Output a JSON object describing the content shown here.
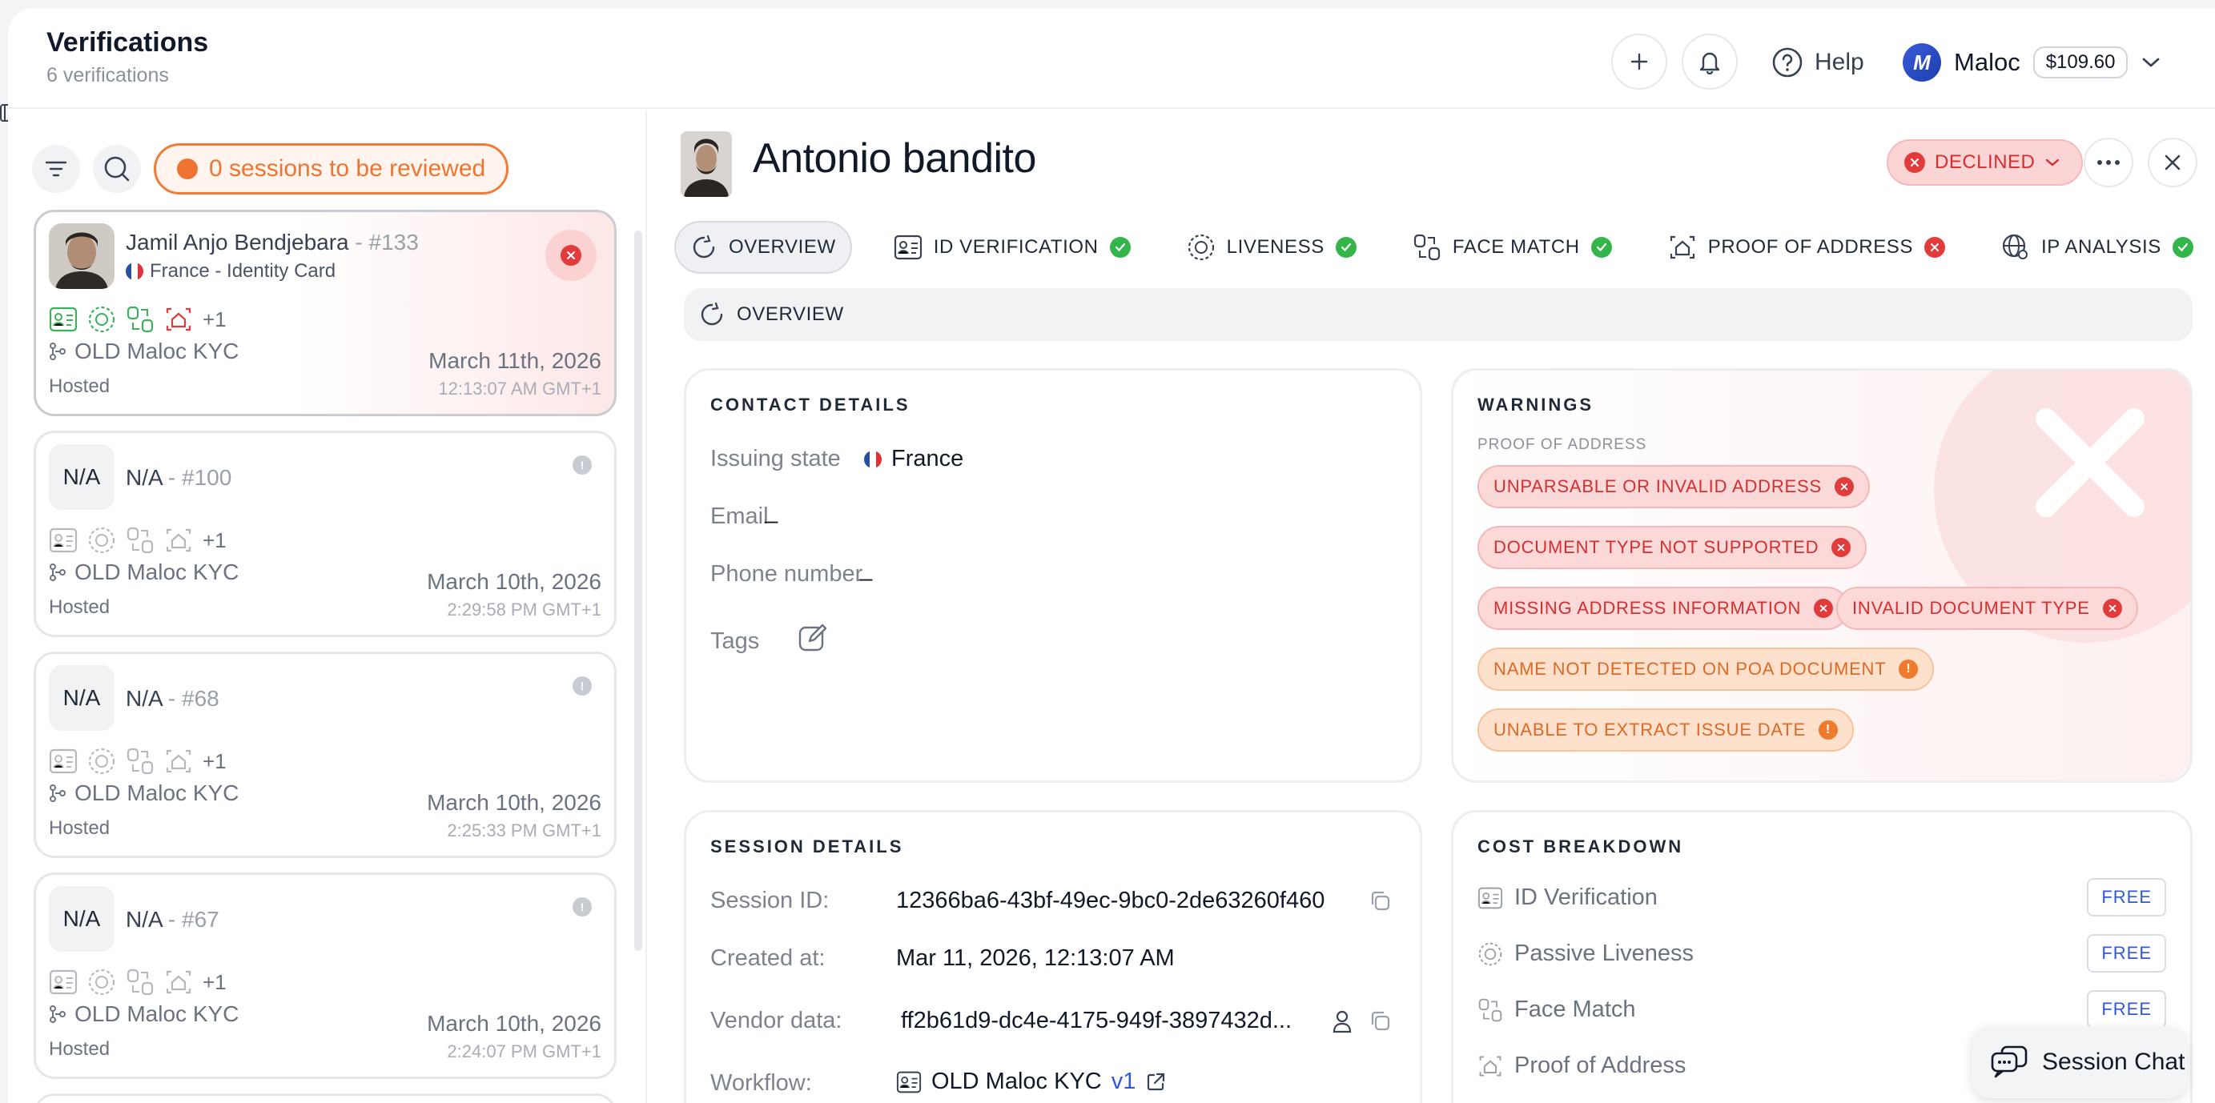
{
  "header": {
    "title": "Verifications",
    "subtitle": "6 verifications",
    "help_label": "Help",
    "user_initial": "M",
    "user_name": "Maloc",
    "balance": "$109.60"
  },
  "sidebar": {
    "review_label": "0 sessions to be reviewed",
    "sessions": [
      {
        "name": "Jamil Anjo Bendjebara",
        "number": "- #133",
        "country": "France - Identity Card",
        "extra_count": "+1",
        "workflow": "OLD Maloc KYC",
        "mode": "Hosted",
        "date": "March 11th, 2026",
        "time": "12:13:07 AM GMT+1",
        "avatar_text": "",
        "status": "declined"
      },
      {
        "name": "N/A",
        "number": "- #100",
        "country": "",
        "extra_count": "+1",
        "workflow": "OLD Maloc KYC",
        "mode": "Hosted",
        "date": "March 10th, 2026",
        "time": "2:29:58 PM GMT+1",
        "avatar_text": "N/A",
        "status": "pending"
      },
      {
        "name": "N/A",
        "number": "- #68",
        "country": "",
        "extra_count": "+1",
        "workflow": "OLD Maloc KYC",
        "mode": "Hosted",
        "date": "March 10th, 2026",
        "time": "2:25:33 PM GMT+1",
        "avatar_text": "N/A",
        "status": "pending"
      },
      {
        "name": "N/A",
        "number": "- #67",
        "country": "",
        "extra_count": "+1",
        "workflow": "OLD Maloc KYC",
        "mode": "Hosted",
        "date": "March 10th, 2026",
        "time": "2:24:07 PM GMT+1",
        "avatar_text": "N/A",
        "status": "pending"
      }
    ]
  },
  "detail": {
    "name": "Antonio bandito",
    "status_label": "DECLINED",
    "tabs": [
      {
        "label": "OVERVIEW",
        "status": "none",
        "icon": "overview-icon"
      },
      {
        "label": "ID VERIFICATION",
        "status": "ok",
        "icon": "id-card-icon"
      },
      {
        "label": "LIVENESS",
        "status": "ok",
        "icon": "liveness-icon"
      },
      {
        "label": "FACE MATCH",
        "status": "ok",
        "icon": "face-match-icon"
      },
      {
        "label": "PROOF OF ADDRESS",
        "status": "fail",
        "icon": "proof-of-address-icon"
      },
      {
        "label": "IP ANALYSIS",
        "status": "ok",
        "icon": "globe-icon"
      }
    ],
    "section_label": "OVERVIEW"
  },
  "contact": {
    "title": "CONTACT DETAILS",
    "issuing_state_label": "Issuing state",
    "issuing_state_value": "France",
    "email_label": "Email",
    "email_value": "_",
    "phone_label": "Phone number",
    "phone_value": "_",
    "tags_label": "Tags"
  },
  "warnings": {
    "title": "WARNINGS",
    "subtitle": "PROOF OF ADDRESS",
    "items": [
      {
        "label": "UNPARSABLE OR INVALID ADDRESS",
        "severity": "error"
      },
      {
        "label": "DOCUMENT TYPE NOT SUPPORTED",
        "severity": "error"
      },
      {
        "label": "MISSING ADDRESS INFORMATION",
        "severity": "error"
      },
      {
        "label": "INVALID DOCUMENT TYPE",
        "severity": "error"
      },
      {
        "label": "NAME NOT DETECTED ON POA DOCUMENT",
        "severity": "warning"
      },
      {
        "label": "UNABLE TO EXTRACT ISSUE DATE",
        "severity": "warning"
      }
    ]
  },
  "session": {
    "title": "SESSION DETAILS",
    "session_id_label": "Session ID:",
    "session_id_value": "12366ba6-43bf-49ec-9bc0-2de63260f460",
    "created_label": "Created at:",
    "created_value": "Mar 11, 2026, 12:13:07 AM",
    "vendor_label": "Vendor data:",
    "vendor_value": "ff2b61d9-dc4e-4175-949f-3897432d...",
    "workflow_label": "Workflow:",
    "workflow_value": "OLD Maloc KYC",
    "workflow_version": "v1"
  },
  "cost": {
    "title": "COST BREAKDOWN",
    "items": [
      {
        "label": "ID Verification",
        "price": "FREE"
      },
      {
        "label": "Passive Liveness",
        "price": "FREE"
      },
      {
        "label": "Face Match",
        "price": "FREE"
      },
      {
        "label": "Proof of Address",
        "price": ""
      }
    ]
  },
  "chat": {
    "label": "Session Chat"
  },
  "colors": {
    "accent_orange": "#ef7433",
    "declined_red": "#e23b3b",
    "success_green": "#33b54a",
    "link_blue": "#3058d9"
  }
}
